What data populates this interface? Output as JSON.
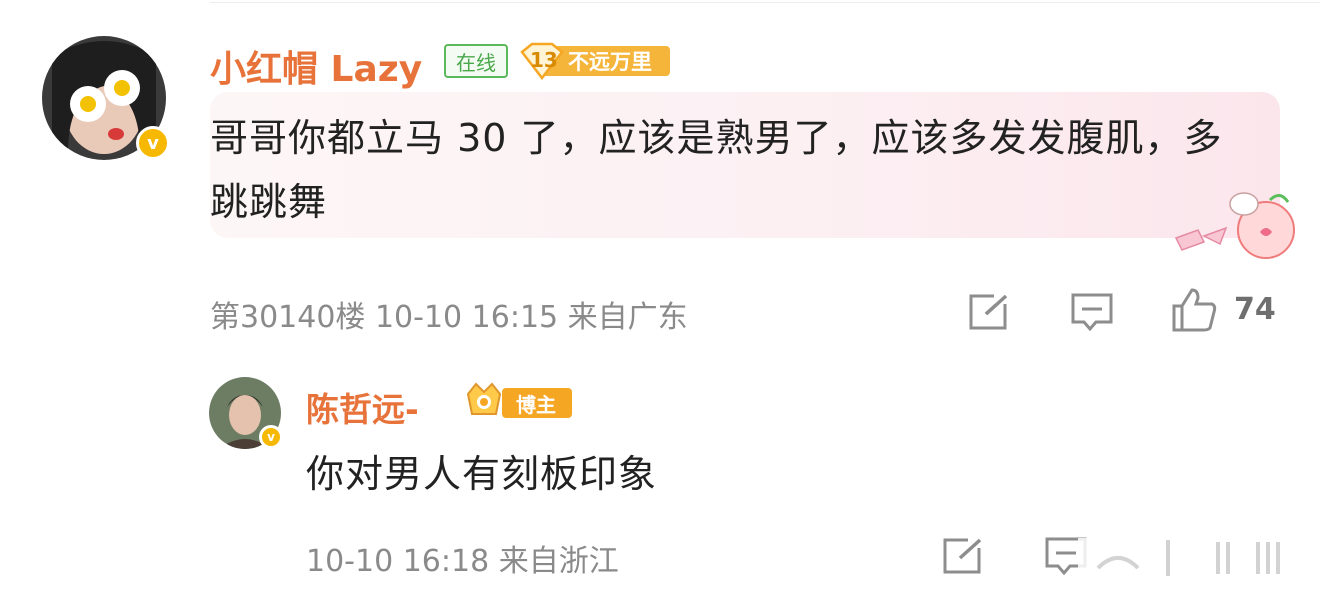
{
  "comment": {
    "username": "小红帽 Lazy",
    "online_badge": "在线",
    "level_number": "13",
    "level_title": "不远万里",
    "verified_mark": "v",
    "text": "哥哥你都立马 30 了，应该是熟男了，应该多发发腹肌，多跳跳舞",
    "meta": "第30140楼 10-10 16:15 来自广东",
    "like_count": "74",
    "icons": [
      "share-icon",
      "comment-icon",
      "like-icon"
    ]
  },
  "reply": {
    "username": "陈哲远-",
    "host_badge": "博主",
    "verified_mark": "v",
    "text": "你对男人有刻板印象",
    "meta": "10-10 16:18 来自浙江",
    "icons": [
      "share-icon",
      "comment-icon"
    ]
  },
  "colors": {
    "username": "#e8733a",
    "verified": "#f6b800",
    "online_green": "#5cb85c",
    "level_gold": "#f5a623",
    "meta_gray": "#8a8a8a"
  }
}
